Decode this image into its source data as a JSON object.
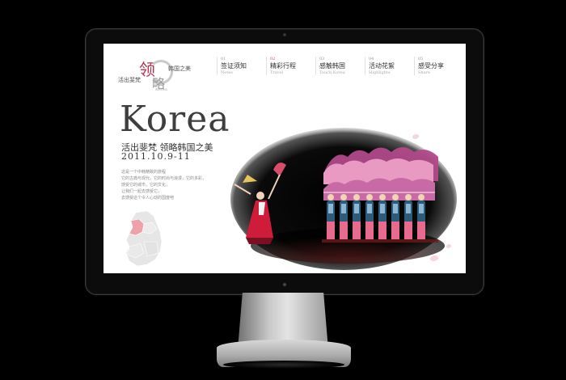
{
  "site": {
    "logo_char_1": "领",
    "logo_char_2": "略",
    "logo_sub_left": "活出斐梵",
    "logo_sub_right": "韩国之美",
    "logo_small": "Korea"
  },
  "nav": {
    "items": [
      {
        "num": "01",
        "zh": "签证须知",
        "en": "Notes",
        "active": false
      },
      {
        "num": "02",
        "zh": "精彩行程",
        "en": "Travel",
        "active": true
      },
      {
        "num": "03",
        "zh": "感触韩国",
        "en": "Touch Korea",
        "active": false
      },
      {
        "num": "04",
        "zh": "活动花絮",
        "en": "Highlights",
        "active": false
      },
      {
        "num": "05",
        "zh": "感受分享",
        "en": "Share",
        "active": false
      }
    ]
  },
  "hero": {
    "title": "Korea",
    "subtitle": "活出斐梵  领略韩国之美",
    "date": "2011.10.9-11",
    "intro_lines": [
      "这是一个中韩精致的旅程",
      "它的古典与现代，它的时尚与浪漫，它的多彩，",
      "感受它的城市，它的文化，",
      "让我们一起去感受它，",
      "去感受这个令人心动的国度吧"
    ]
  },
  "colors": {
    "accent": "#c0526a",
    "map_highlight": "#f0a0a8",
    "map_base": "#e6e6e6",
    "bezel": "#0c0c0c"
  }
}
